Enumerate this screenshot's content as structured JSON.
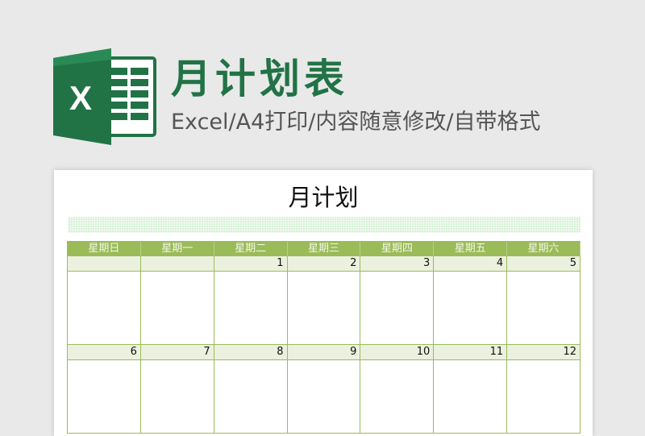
{
  "header": {
    "title": "月计划表",
    "subtitle": "Excel/A4打印/内容随意修改/自带格式",
    "logo_letter": "X",
    "logo_icon": "excel-icon"
  },
  "sheet": {
    "title": "月计划",
    "weekdays": [
      "星期日",
      "星期一",
      "星期二",
      "星期三",
      "星期四",
      "星期五",
      "星期六"
    ],
    "weeks": [
      [
        "",
        "",
        "1",
        "2",
        "3",
        "4",
        "5"
      ],
      [
        "6",
        "7",
        "8",
        "9",
        "10",
        "11",
        "12"
      ]
    ]
  },
  "colors": {
    "brand": "#217346",
    "header_row": "#9bbb59",
    "date_row": "#ebf1de",
    "band": "#d7f1d7"
  }
}
